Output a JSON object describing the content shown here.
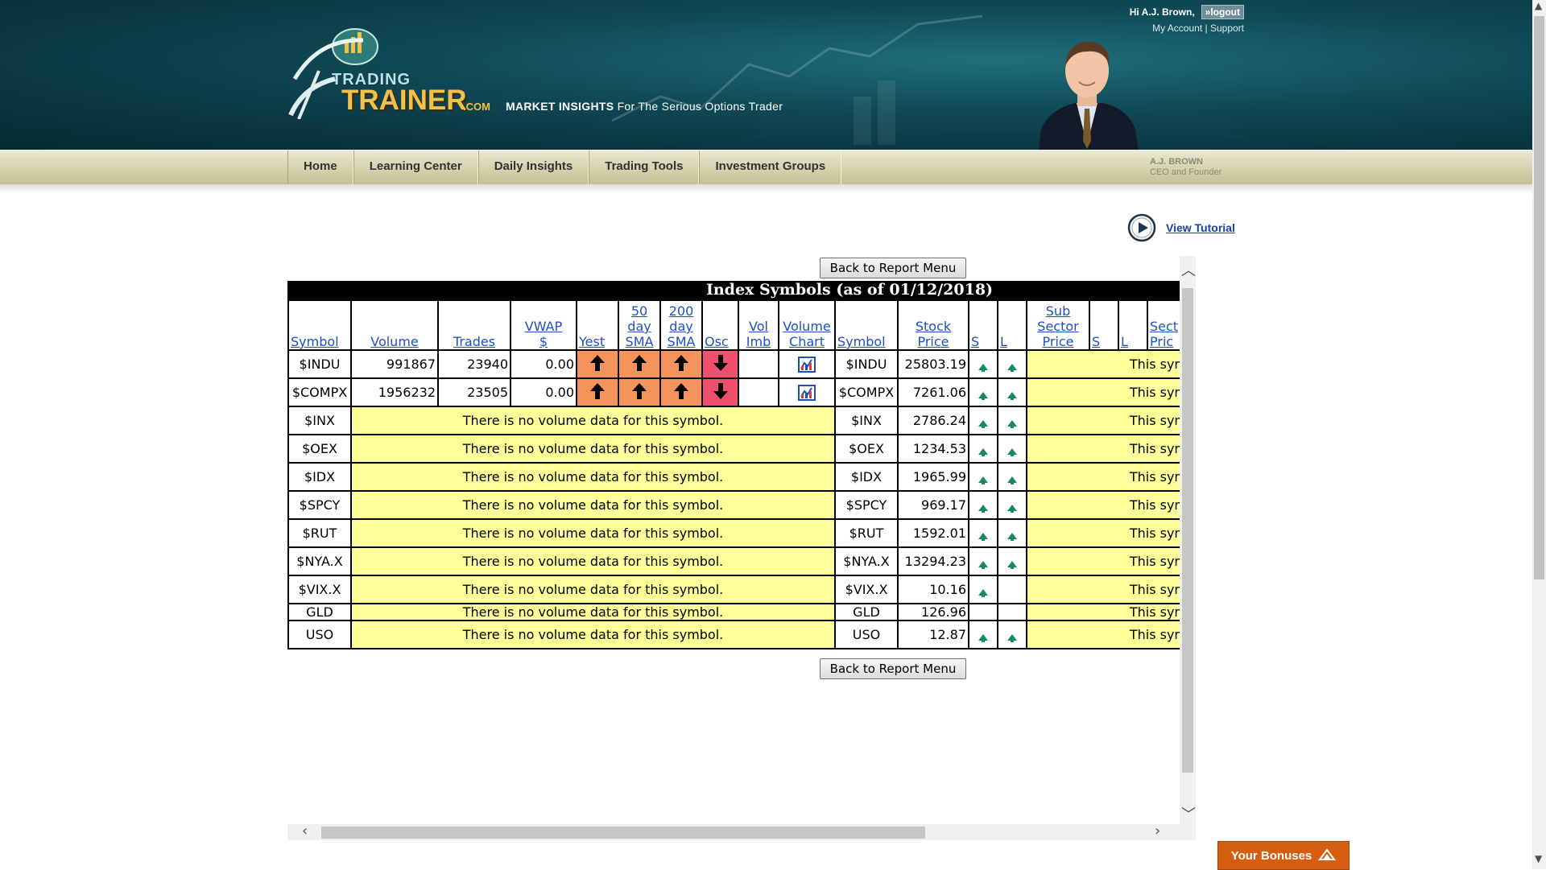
{
  "header": {
    "logo_trading": "TRADING",
    "logo_trainer": "TRAINER",
    "logo_com": ".COM",
    "tagline_bold": "MARKET INSIGHTS",
    "tagline_rest": " For The Serious Options Trader",
    "ceo_name": "A.J. BROWN",
    "ceo_title": "CEO and Founder"
  },
  "user": {
    "greeting": "Hi A.J. Brown,",
    "logout_label": "»logout",
    "my_account": "My Account",
    "separator": "|",
    "support": "Support"
  },
  "nav": {
    "items": [
      {
        "label": "Home"
      },
      {
        "label": "Learning Center"
      },
      {
        "label": "Daily Insights"
      },
      {
        "label": "Trading Tools"
      },
      {
        "label": "Investment Groups"
      }
    ]
  },
  "tutorial": {
    "label": "View Tutorial"
  },
  "report": {
    "back_label": "Back to Report Menu",
    "title": "Index Symbols (as of 01/12/2018)",
    "no_volume_msg": "There is no volume data for this symbol.",
    "this_symbol_msg": "This sym",
    "headers": {
      "symbol": "Symbol",
      "volume": "Volume",
      "trades": "Trades",
      "vwap": [
        "VWAP",
        "$"
      ],
      "yest": "Yest",
      "sma50": [
        "50",
        "day",
        "SMA"
      ],
      "sma200": [
        "200",
        "day",
        "SMA"
      ],
      "osc": "Osc",
      "vol_imb": [
        "Vol",
        "Imb"
      ],
      "volume_chart": [
        "Volume",
        "Chart"
      ],
      "symbol2": "Symbol",
      "stock_price": [
        "Stock",
        "Price"
      ],
      "s": "S",
      "l": "L",
      "sub_sector_price": [
        "Sub",
        "Sector",
        "Price"
      ],
      "s2": "S",
      "l2": "L",
      "sector_price": [
        "Sect",
        "Pric"
      ]
    },
    "rows": [
      {
        "symbol": "$INDU",
        "volume": "991867",
        "trades": "23940",
        "vwap": "0.00",
        "price": "25803.19"
      },
      {
        "symbol": "$COMPX",
        "volume": "1956232",
        "trades": "23505",
        "vwap": "0.00",
        "price": "7261.06"
      },
      {
        "symbol": "$INX",
        "price": "2786.24"
      },
      {
        "symbol": "$OEX",
        "price": "1234.53"
      },
      {
        "symbol": "$IDX",
        "price": "1965.99"
      },
      {
        "symbol": "$SPCY",
        "price": "969.17"
      },
      {
        "symbol": "$RUT",
        "price": "1592.01"
      },
      {
        "symbol": "$NYA.X",
        "price": "13294.23"
      },
      {
        "symbol": "$VIX.X",
        "price": "10.16"
      },
      {
        "symbol": "GLD",
        "price": "126.96"
      },
      {
        "symbol": "USO",
        "price": "12.87"
      }
    ]
  },
  "bonuses": {
    "label": "Your Bonuses"
  },
  "colors": {
    "header_bg": "#0f4a56",
    "nav_bg": "#d2cfa9",
    "arrow_up_cell": "#f5935c",
    "arrow_down_cell": "#f0506e",
    "message_cell": "#ffff99",
    "link_blue": "#1f4fc7",
    "bonuses_bg": "#d45d10"
  }
}
